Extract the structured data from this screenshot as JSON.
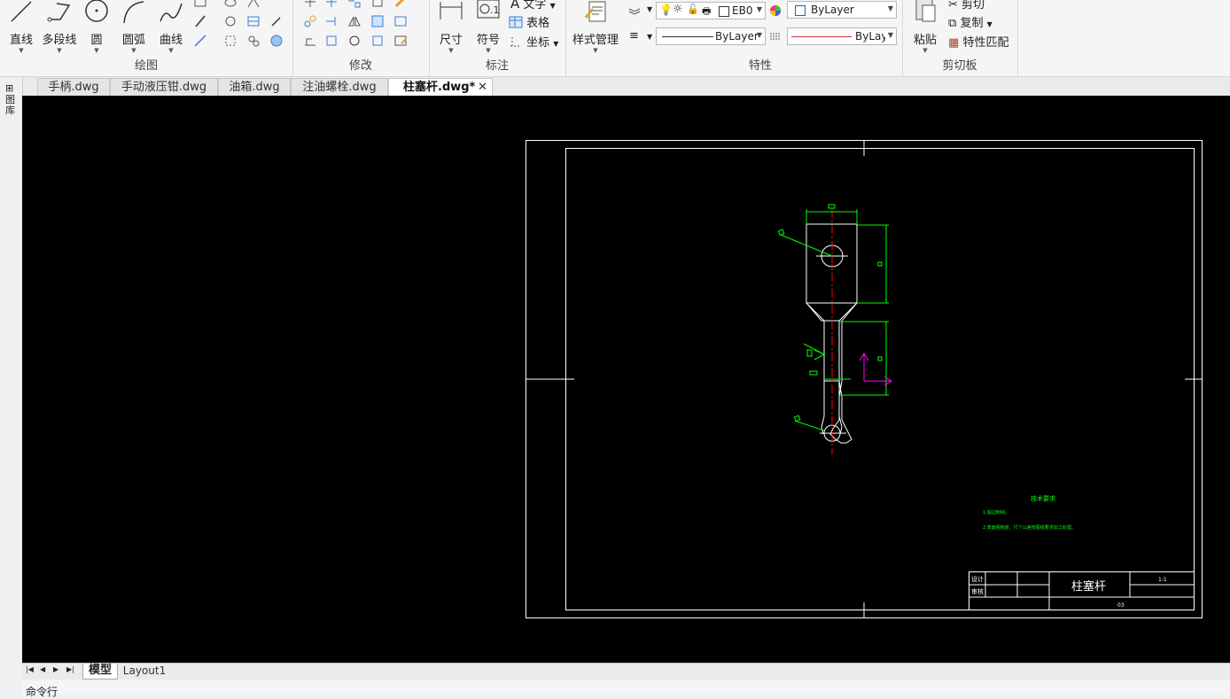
{
  "ribbon": {
    "draw": {
      "label": "绘图",
      "line": "直线",
      "polyline": "多段线",
      "circle": "圆",
      "arc": "圆弧",
      "curve": "曲线"
    },
    "modify": {
      "label": "修改"
    },
    "annotation": {
      "label": "标注",
      "dimension": "尺寸",
      "symbol": "符号",
      "text": "文字",
      "table": "表格",
      "coordinate": "坐标"
    },
    "style": {
      "label": "样式管理"
    },
    "properties": {
      "label": "特性",
      "layer_value": "EB0",
      "color_value": "ByLayer",
      "linetype_value": "ByLayer",
      "lineweight_value": "ByLay…"
    },
    "clipboard": {
      "label": "剪切板",
      "paste": "粘贴",
      "cut": "剪切",
      "copy": "复制",
      "match": "特性匹配"
    }
  },
  "left_panel": {
    "label": "图库"
  },
  "doc_tabs": [
    {
      "name": "手柄.dwg"
    },
    {
      "name": "手动液压钳.dwg"
    },
    {
      "name": "油箱.dwg"
    },
    {
      "name": "注油螺栓.dwg"
    },
    {
      "name": "柱塞杆.dwg*"
    }
  ],
  "drawing": {
    "title": "柱塞杆",
    "scale": "1:1",
    "tech_title": "技术要求",
    "tech_line1": "1.锐边倒钝。",
    "tech_line2": "2.表面粗糙度、尺寸公差按图纸要求加工处理。",
    "tb_designer": "设计",
    "tb_checker": "审核",
    "tb_num": "03"
  },
  "layout_tabs": {
    "model": "模型",
    "layout1": "Layout1"
  },
  "command": {
    "label": "命令行"
  },
  "colors": {
    "bg": "#000000",
    "frame": "#ffffff",
    "dim": "#00ff00",
    "center": "#ff0000",
    "ucs": "#ff00ff"
  }
}
